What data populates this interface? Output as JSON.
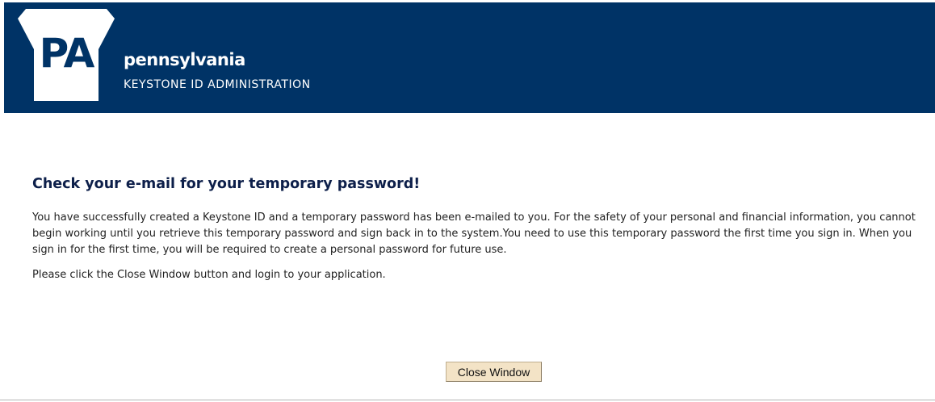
{
  "header": {
    "logo_text": "PA",
    "brand_name": "pennsylvania",
    "brand_subtitle": "KEYSTONE ID ADMINISTRATION"
  },
  "main": {
    "heading": "Check your e-mail for your temporary password!",
    "message": "You have successfully created a Keystone ID and a temporary password has been e-mailed to you. For the safety of your personal and financial information, you cannot begin working until you retrieve this temporary password and sign back in to the system.You need to use this temporary password the first time you sign in. When you sign in for the first time, you will be required to create a personal password for future use.",
    "instruction": "Please click the Close Window button and login to your application."
  },
  "actions": {
    "close_label": "Close Window"
  },
  "colors": {
    "header_bg": "#003366",
    "heading_text": "#0d1f4a",
    "button_bg": "#f3e3c6"
  },
  "icons": {
    "logo": "keystone-icon"
  }
}
